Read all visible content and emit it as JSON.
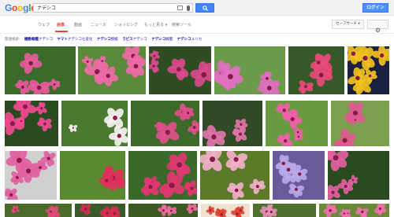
{
  "logo": {
    "letters": [
      "G",
      "o",
      "o",
      "g",
      "l",
      "e"
    ],
    "colors": [
      "#4285f4",
      "#ea4335",
      "#fbbc05",
      "#4285f4",
      "#34a853",
      "#ea4335"
    ]
  },
  "search": {
    "query": "ナデシコ"
  },
  "header": {
    "login_label": "ログイン"
  },
  "tabs": [
    {
      "label": "ウェブ"
    },
    {
      "label": "画像"
    },
    {
      "label": "動画"
    },
    {
      "label": "ニュース"
    },
    {
      "label": "ショッピング"
    },
    {
      "label": "もっと見る ▾"
    },
    {
      "label": "検索ツール"
    }
  ],
  "safesearch_label": "セーフサーチ ▾",
  "related": {
    "title": "関連検索:",
    "items": [
      {
        "label_bold": "機動戦艦",
        "label": "ナデシコ"
      },
      {
        "label_bold": "ヤマト",
        "label": "ナデシコ七変化"
      },
      {
        "label_bold": "ナデシコ",
        "label": "壁紙"
      },
      {
        "label_bold": "ラピス",
        "label": "ナデシコ"
      },
      {
        "label_bold": "ナデシコ",
        "label": "戦艦"
      },
      {
        "label_bold": "ナデシコ",
        "label": "ユリカ"
      }
    ]
  },
  "image_rows": [
    [
      {
        "color": "#e85a9c",
        "bg": "#3a6b2a"
      },
      {
        "color": "#f06aa8",
        "bg": "#5a8a3a"
      },
      {
        "color": "#d94a8c",
        "bg": "#2e4d22"
      },
      {
        "color": "#e070c0",
        "bg": "#6a9a4a"
      },
      {
        "color": "#e84a7a",
        "bg": "#355a28"
      },
      {
        "color": "#f0c020",
        "bg": "#1a2040"
      }
    ],
    [
      {
        "color": "#f04a90",
        "bg": "#2a4a20"
      },
      {
        "color": "#f5f0f0",
        "bg": "#4a7a30"
      },
      {
        "color": "#e0508c",
        "bg": "#3d6a2a"
      },
      {
        "color": "#e074a8",
        "bg": "#2f4a24"
      },
      {
        "color": "#f060a8",
        "bg": "#6a9a40"
      },
      {
        "color": "#e05890",
        "bg": "#7aa050"
      }
    ],
    [
      {
        "color": "#e060a0",
        "bg": "#d0d0d0"
      },
      {
        "color": "#e0305a",
        "bg": "#5a8a30"
      },
      {
        "color": "#e03870",
        "bg": "#3a6a2a"
      },
      {
        "color": "#f0b0c8",
        "bg": "#5a7a2a"
      },
      {
        "color": "#b8a8e8",
        "bg": "#6a5a9a"
      },
      {
        "color": "#e060a0",
        "bg": "#2a4a20"
      }
    ],
    [
      {
        "color": "#e04a7a",
        "bg": "#4a6a2a"
      },
      {
        "color": "#d03050",
        "bg": "#3a5a2a"
      },
      {
        "color": "#f06aa0",
        "bg": "#3a5a22"
      },
      {
        "color": "#e04030",
        "bg": "#f0e0d0"
      },
      {
        "color": "#e090b0",
        "bg": "#507030"
      },
      {
        "color": "#f070b0",
        "bg": "#6a8a3a"
      }
    ]
  ]
}
